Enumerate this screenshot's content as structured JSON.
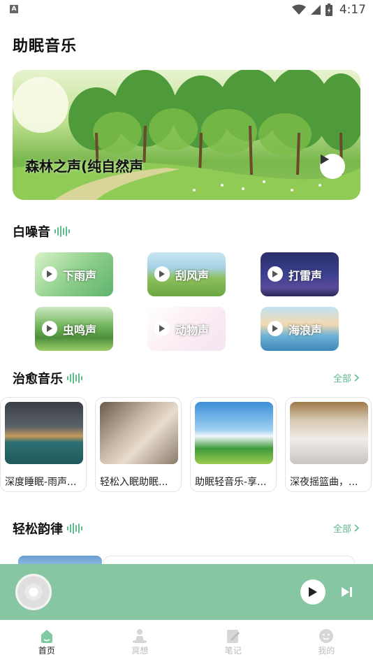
{
  "status_bar": {
    "time": "4:17",
    "a_badge": "A"
  },
  "page": {
    "title": "助眠音乐"
  },
  "banner": {
    "title": "森林之声(纯自然声"
  },
  "white_noise": {
    "title": "白噪音",
    "items": [
      {
        "label": "下雨声"
      },
      {
        "label": "刮风声"
      },
      {
        "label": "打雷声"
      },
      {
        "label": "虫鸣声"
      },
      {
        "label": "动物声"
      },
      {
        "label": "海浪声"
      }
    ]
  },
  "healing_music": {
    "title": "治愈音乐",
    "see_all": "全部",
    "items": [
      {
        "title": "深度睡眠-雨声..."
      },
      {
        "title": "轻松入眠助眠..."
      },
      {
        "title": "助眠轻音乐-享..."
      },
      {
        "title": "深夜摇篮曲，..."
      }
    ]
  },
  "relaxing_rhythm": {
    "title": "轻松韵律",
    "see_all": "全部"
  },
  "bottom_nav": {
    "items": [
      {
        "label": "首页",
        "active": true
      },
      {
        "label": "冥想"
      },
      {
        "label": "笔记"
      },
      {
        "label": "我的"
      }
    ]
  },
  "colors": {
    "accent": "#5dbb8a",
    "player_bar": "#86c6a2"
  }
}
